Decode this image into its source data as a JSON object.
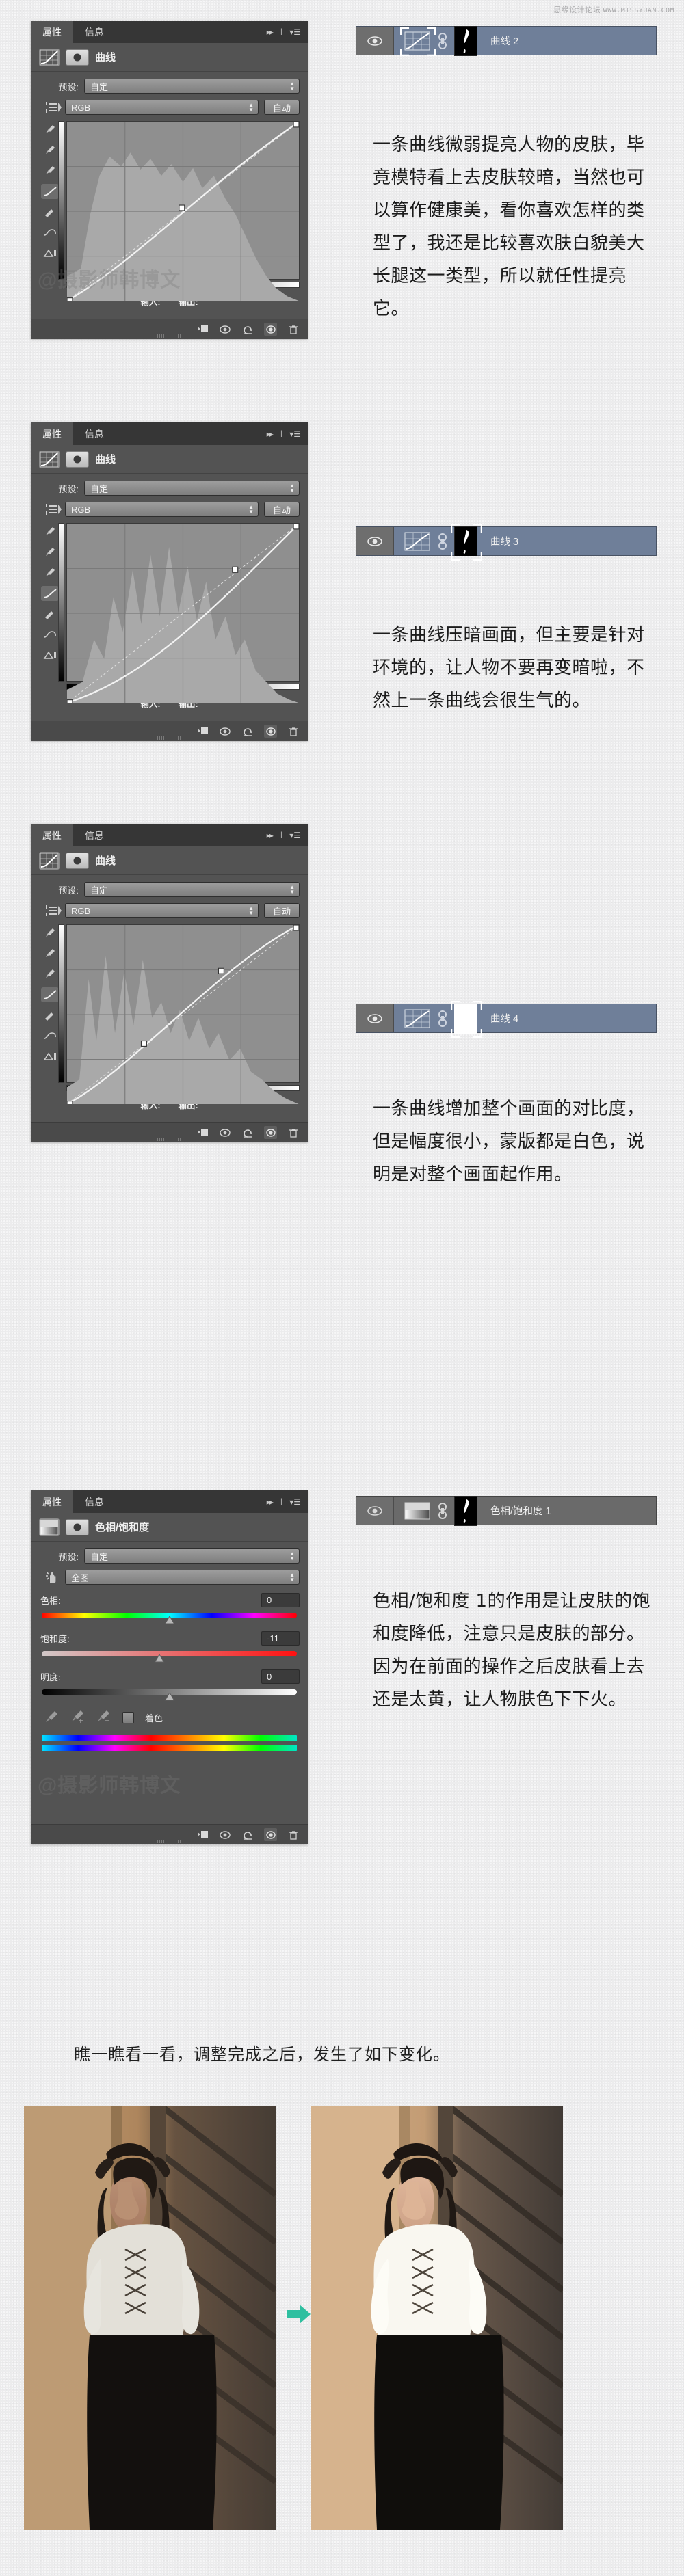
{
  "watermark": {
    "top_right_cn": "思缘设计论坛",
    "top_right_url": "WWW.MISSYUAN.COM",
    "panel_watermark": "@摄影师韩博文"
  },
  "panels": [
    {
      "id": "curves2",
      "tabs": [
        "属性",
        "信息"
      ],
      "active_tab": "属性",
      "title": "曲线",
      "preset_label": "预设:",
      "preset_value": "自定",
      "channel_value": "RGB",
      "auto_label": "自动",
      "input_label": "输入:",
      "output_label": "输出:",
      "icon_names": [
        "curves-icon",
        "mask-icon",
        "hand-scrub-icon",
        "eyedropper-black-icon",
        "eyedropper-gray-icon",
        "eyedropper-white-icon",
        "curve-pencil-icon",
        "smooth-icon",
        "clip-warning-icon"
      ]
    },
    {
      "id": "curves3",
      "tabs": [
        "属性",
        "信息"
      ],
      "active_tab": "属性",
      "title": "曲线",
      "preset_label": "预设:",
      "preset_value": "自定",
      "channel_value": "RGB",
      "auto_label": "自动",
      "input_label": "输入:",
      "output_label": "输出:"
    },
    {
      "id": "curves4",
      "tabs": [
        "属性",
        "信息"
      ],
      "active_tab": "属性",
      "title": "曲线",
      "preset_label": "预设:",
      "preset_value": "自定",
      "channel_value": "RGB",
      "auto_label": "自动",
      "input_label": "输入:",
      "output_label": "输出:"
    },
    {
      "id": "huesat",
      "tabs": [
        "属性",
        "信息"
      ],
      "active_tab": "属性",
      "title": "色相/饱和度",
      "preset_label": "预设:",
      "preset_value": "自定",
      "channel_value": "全图",
      "hue_label": "色相:",
      "hue_value": "0",
      "sat_label": "饱和度:",
      "sat_value": "-11",
      "light_label": "明度:",
      "light_value": "0",
      "colorize_label": "着色"
    }
  ],
  "layers": [
    {
      "name": "曲线 2",
      "mask": "black-with-white-figure",
      "selected_thumb": "adjustment"
    },
    {
      "name": "曲线 3",
      "mask": "black-with-white-figure",
      "selected_thumb": "mask"
    },
    {
      "name": "曲线 4",
      "mask": "white",
      "selected_thumb": "mask"
    },
    {
      "name": "色相/饱和度 1",
      "mask": "black-with-white-figure",
      "selected_thumb": "none"
    }
  ],
  "paragraphs": [
    "一条曲线微弱提亮人物的皮肤，毕竟模特看上去皮肤较暗，当然也可以算作健康美，看你喜欢怎样的类型了，我还是比较喜欢肤白貌美大长腿这一类型，所以就任性提亮它。",
    "一条曲线压暗画面，但主要是针对环境的，让人物不要再变暗啦，不然上一条曲线会很生气的。",
    "一条曲线增加整个画面的对比度，但是幅度很小，蒙版都是白色，说明是对整个画面起作用。",
    "色相/饱和度 1的作用是让皮肤的饱和度降低，注意只是皮肤的部分。因为在前面的操作之后皮肤看上去还是太黄，让人物肤色下下火。"
  ],
  "caption": "瞧一瞧看一看，调整完成之后，发生了如下变化。",
  "colors": {
    "page_bg": "#ececed",
    "panel_bg": "#535353",
    "panel_tabbar": "#363636",
    "layer_selected": "#6f7f99",
    "layer_unselected": "#6a6a6a",
    "graph_bg": "#8f8f8f",
    "arrow_green": "#2fbfa0"
  }
}
